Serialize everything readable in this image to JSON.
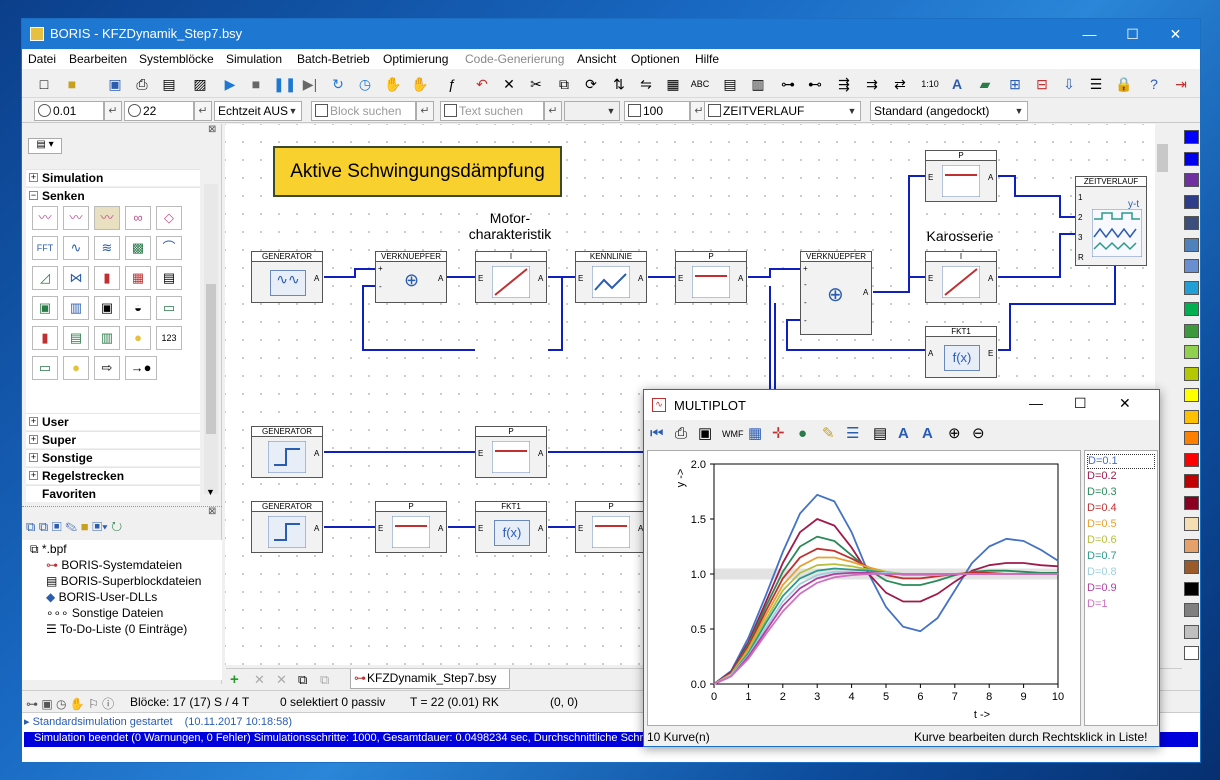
{
  "window": {
    "title": "BORIS - KFZDynamik_Step7.bsy",
    "minimize": "—",
    "maximize": "☐",
    "close": "✕"
  },
  "menu": [
    "Datei",
    "Bearbeiten",
    "Systemblöcke",
    "Simulation",
    "Batch-Betrieb",
    "Optimierung",
    "Code-Generierung",
    "Ansicht",
    "Optionen",
    "Hilfe"
  ],
  "toolbar2": {
    "step": "0.01",
    "end_time": "22",
    "realtime": "Echtzeit AUS",
    "block_search": "Block suchen",
    "text_search": "Text suchen",
    "zoom": "100",
    "view": "ZEITVERLAUF",
    "layout": "Standard (angedockt)"
  },
  "left": {
    "categories": [
      "Simulation",
      "Senken",
      "User",
      "Super",
      "Sonstige",
      "Regelstrecken",
      "Favoriten"
    ],
    "tree_root": "*.bpf",
    "tree_items": [
      "BORIS-Systemdateien",
      "BORIS-Superblockdateien",
      "BORIS-User-DLLs",
      "Sonstige Dateien",
      "To-Do-Liste (0 Einträge)"
    ]
  },
  "canvas": {
    "title": "Aktive Schwingungsdämpfung",
    "label_motor": "Motor-\ncharakteristik",
    "label_karosserie": "Karosserie",
    "blocks": {
      "generator": "GENERATOR",
      "verknuepfer": "VERKNUEPFER",
      "i": "I",
      "kennlinie": "KENNLINIE",
      "p": "P",
      "fkt1": "FKT1",
      "zeitverlauf": "ZEITVERLAUF"
    },
    "pins": {
      "a": "A",
      "e": "E",
      "plus": "+",
      "minus": "-",
      "fx": "f(x)",
      "yt": "y-t",
      "zv_pins": [
        "1",
        "2",
        "3",
        "R"
      ]
    }
  },
  "tab": {
    "file": "KFZDynamik_Step7.bsy"
  },
  "status": {
    "blocks": "Blöcke: 17 (17) S / 4 T",
    "selection": "0 selektiert  0 passiv",
    "time": "T = 22  (0.01)  RK",
    "coords": "(0, 0)"
  },
  "messages": [
    {
      "text": "Standardsimulation gestartet",
      "time": "(10.11.2017 10:18:58)"
    },
    {
      "text": "Simulation beendet (0 Warnungen, 0 Fehler)    Simulationsschritte: 1000, Gesamtdauer:  0.0498234 sec, Durchschnittliche Schri"
    }
  ],
  "colors": [
    "#0000ff",
    "#0000ee",
    "#7030a0",
    "#2e3c8c",
    "#3c4e7a",
    "#4f81bd",
    "#6a8fd0",
    "#21a0d8",
    "#00b050",
    "#3c9a3c",
    "#92d050",
    "#b4c800",
    "#ffff00",
    "#ffc000",
    "#ff7f00",
    "#ff0000",
    "#c00000",
    "#8b0020",
    "#f5deb3",
    "#e6a06a",
    "#9c5a2a",
    "#000000",
    "#808080",
    "#bfbfbf",
    "#ffffff"
  ],
  "multiplot": {
    "title": "MULTIPLOT",
    "curve_count": "10 Kurve(n)",
    "hint": "Kurve bearbeiten durch Rechtsklick in Liste!"
  },
  "chart_data": {
    "type": "line",
    "title": "",
    "xlabel": "t ->",
    "ylabel": "y ->",
    "xlim": [
      0,
      10
    ],
    "ylim": [
      0,
      2.0
    ],
    "xticks": [
      "0",
      "1",
      "2",
      "3",
      "4",
      "5",
      "6",
      "7",
      "8",
      "9",
      "10"
    ],
    "yticks": [
      "0.0",
      "0.5",
      "1.0",
      "1.5",
      "2.0"
    ],
    "x": [
      0,
      0.5,
      1,
      1.5,
      2,
      2.5,
      3,
      3.5,
      4,
      4.5,
      5,
      5.5,
      6,
      6.5,
      7,
      7.5,
      8,
      8.5,
      9,
      9.5,
      10
    ],
    "series": [
      {
        "name": "D=0.1",
        "color": "#4472c4",
        "values": [
          0,
          0.12,
          0.42,
          0.8,
          1.2,
          1.55,
          1.72,
          1.66,
          1.38,
          1.0,
          0.7,
          0.52,
          0.48,
          0.6,
          0.85,
          1.1,
          1.25,
          1.32,
          1.3,
          1.22,
          1.12
        ]
      },
      {
        "name": "D=0.2",
        "color": "#a01a4a",
        "values": [
          0,
          0.11,
          0.38,
          0.74,
          1.1,
          1.38,
          1.5,
          1.44,
          1.24,
          1.0,
          0.83,
          0.75,
          0.75,
          0.82,
          0.93,
          1.03,
          1.08,
          1.1,
          1.1,
          1.08,
          1.07
        ]
      },
      {
        "name": "D=0.3",
        "color": "#2a8a5a",
        "values": [
          0,
          0.1,
          0.36,
          0.7,
          1.02,
          1.25,
          1.34,
          1.3,
          1.17,
          1.04,
          0.94,
          0.9,
          0.9,
          0.94,
          0.99,
          1.02,
          1.03,
          1.03,
          1.02,
          1.01,
          1.01
        ]
      },
      {
        "name": "D=0.4",
        "color": "#c03030",
        "values": [
          0,
          0.1,
          0.34,
          0.66,
          0.96,
          1.15,
          1.23,
          1.21,
          1.14,
          1.06,
          0.99,
          0.96,
          0.96,
          0.98,
          1.0,
          1.01,
          1.01,
          1.0,
          1.0,
          1.0,
          1.0
        ]
      },
      {
        "name": "D=0.5",
        "color": "#e8a030",
        "values": [
          0,
          0.09,
          0.32,
          0.62,
          0.9,
          1.07,
          1.15,
          1.15,
          1.11,
          1.06,
          1.02,
          0.99,
          0.99,
          0.99,
          1.0,
          1.0,
          1.0,
          1.0,
          1.0,
          1.0,
          1.0
        ]
      },
      {
        "name": "D=0.6",
        "color": "#b4c040",
        "values": [
          0,
          0.09,
          0.3,
          0.58,
          0.85,
          1.01,
          1.08,
          1.09,
          1.07,
          1.04,
          1.02,
          1.0,
          1.0,
          1.0,
          1.0,
          1.0,
          1.0,
          1.0,
          1.0,
          1.0,
          1.0
        ]
      },
      {
        "name": "D=0.7",
        "color": "#2a9a8a",
        "values": [
          0,
          0.08,
          0.28,
          0.55,
          0.8,
          0.96,
          1.03,
          1.05,
          1.04,
          1.03,
          1.01,
          1.0,
          1.0,
          1.0,
          1.0,
          1.0,
          1.0,
          1.0,
          1.0,
          1.0,
          1.0
        ]
      },
      {
        "name": "D=0.8",
        "color": "#a0d0e0",
        "values": [
          0,
          0.08,
          0.26,
          0.51,
          0.75,
          0.91,
          0.99,
          1.02,
          1.02,
          1.01,
          1.01,
          1.0,
          1.0,
          1.0,
          1.0,
          1.0,
          1.0,
          1.0,
          1.0,
          1.0,
          1.0
        ]
      },
      {
        "name": "D=0.9",
        "color": "#b040a0",
        "values": [
          0,
          0.07,
          0.25,
          0.48,
          0.71,
          0.87,
          0.96,
          1.0,
          1.01,
          1.01,
          1.0,
          1.0,
          1.0,
          1.0,
          1.0,
          1.0,
          1.0,
          1.0,
          1.0,
          1.0,
          1.0
        ]
      },
      {
        "name": "D=1",
        "color": "#d070c0",
        "values": [
          0,
          0.07,
          0.23,
          0.45,
          0.66,
          0.82,
          0.92,
          0.97,
          0.99,
          1.0,
          1.0,
          1.0,
          1.0,
          1.0,
          1.0,
          1.0,
          1.0,
          1.0,
          1.0,
          1.0,
          1.0
        ]
      }
    ]
  }
}
